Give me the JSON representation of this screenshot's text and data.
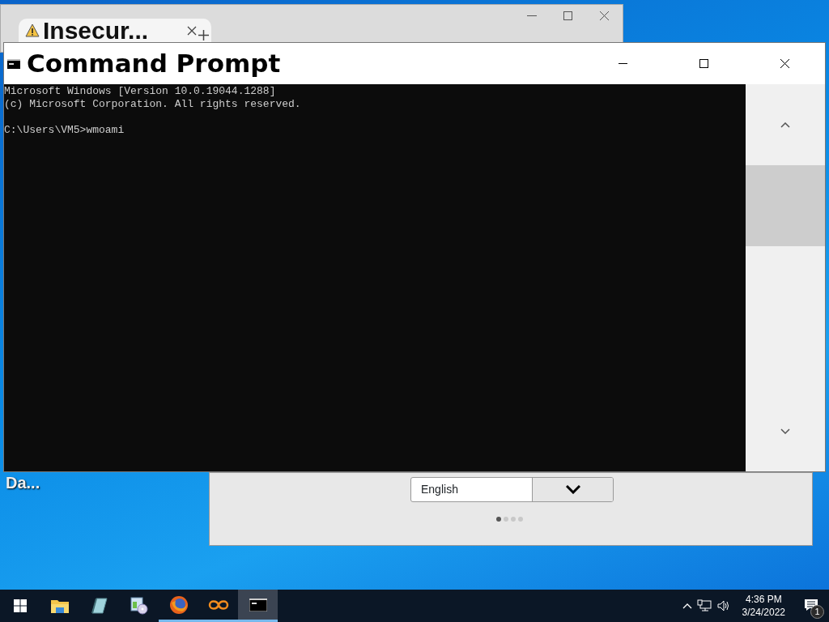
{
  "browser": {
    "tab_title": "Insecur..."
  },
  "desktop_label": "Da...",
  "cmd": {
    "title": "Command Prompt",
    "lines": [
      "Microsoft Windows [Version 10.0.19044.1288]",
      "(c) Microsoft Corporation. All rights reserved."
    ],
    "prompt": "C:\\Users\\VM5>wmoami"
  },
  "dialog": {
    "language": "English",
    "dots": [
      {
        "selected": true
      },
      {
        "selected": false
      },
      {
        "selected": false
      },
      {
        "selected": false
      }
    ]
  },
  "taskbar": {
    "apps": [
      {
        "kind": "start",
        "running": false,
        "active": false
      },
      {
        "kind": "folder",
        "running": false,
        "active": false
      },
      {
        "kind": "notepad",
        "running": false,
        "active": false
      },
      {
        "kind": "media",
        "running": false,
        "active": false
      },
      {
        "kind": "firefox",
        "running": true,
        "active": false
      },
      {
        "kind": "link",
        "running": true,
        "active": false
      },
      {
        "kind": "console",
        "running": true,
        "active": true
      }
    ],
    "time": "4:36 PM",
    "date": "3/24/2022",
    "notifications": "1"
  }
}
